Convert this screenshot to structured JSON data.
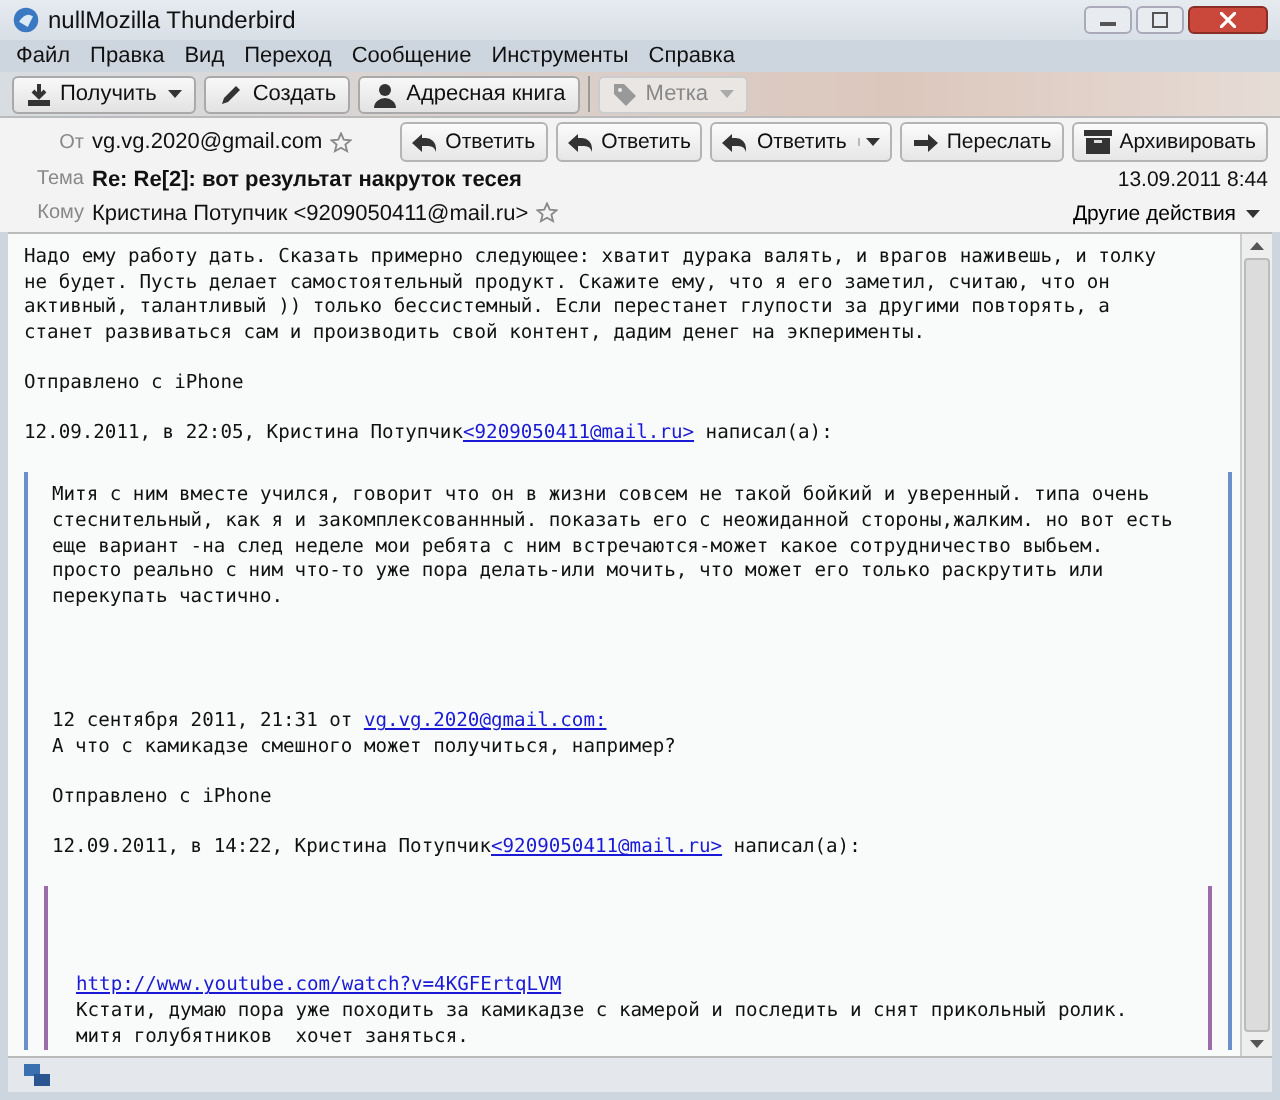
{
  "window": {
    "title": "nullMozilla Thunderbird"
  },
  "menu": [
    {
      "label": "Файл"
    },
    {
      "label": "Правка"
    },
    {
      "label": "Вид"
    },
    {
      "label": "Переход"
    },
    {
      "label": "Сообщение"
    },
    {
      "label": "Инструменты"
    },
    {
      "label": "Справка"
    }
  ],
  "toolbar": [
    {
      "label": "Получить",
      "dropdown": true,
      "disabled": false
    },
    {
      "label": "Создать",
      "dropdown": false,
      "disabled": false
    },
    {
      "label": "Адресная книга",
      "dropdown": false,
      "disabled": false
    },
    {
      "label": "Метка",
      "dropdown": true,
      "disabled": true
    }
  ],
  "message": {
    "from_label": "От",
    "from": "vg.vg.2020@gmail.com",
    "subject_label": "Тема",
    "subject": "Re: Re[2]: вот результат накруток тесея",
    "to_label": "Кому",
    "to": "Кристина Потупчик <9209050411@mail.ru>",
    "date": "13.09.2011 8:44",
    "other_actions": "Другие действия",
    "actions": [
      {
        "label": "Ответить",
        "dropdown": false
      },
      {
        "label": "Ответить",
        "dropdown": false
      },
      {
        "label": "Ответить",
        "dropdown": true
      },
      {
        "label": "Переслать",
        "dropdown": false
      },
      {
        "label": "Архивировать",
        "dropdown": false
      }
    ]
  },
  "body": [
    {
      "kind": "para",
      "text": "Надо ему работу дать. Сказать примерно следующее: хватит дурака валять, и врагов наживешь, и толку\nне будет. Пусть делает самостоятельный продукт. Скажите ему, что я его заметил, считаю, что он\nактивный, талантливый )) только бессистемный. Если перестанет глупости за другими повторять, а\nстанет развиваться сам и производить свой контент, дадим денег на экперименты."
    },
    {
      "kind": "para",
      "text": "Отправлено с iPhone"
    },
    {
      "kind": "attribution",
      "before": "12.09.2011, в 22:05, Кристина Потупчик",
      "link": "<9209050411@mail.ru>",
      "after": " написал(а):"
    },
    {
      "kind": "quote",
      "children": [
        {
          "kind": "para",
          "text": "Митя с ним вместе учился, говорит что он в жизни совсем не такой бойкий и уверенный. типа очень\nстеснительный, как я и закомплексованнный. показать его с неожиданной стороны,жалким. но вот есть\nеще вариант -на след неделе мои ребята с ним встречаются-может какое сотрудничество выбьем.\nпросто реально с ним что-то уже пора делать-или мочить, что может его только раскрутить или\nперекупать частично."
        },
        {
          "kind": "attribution",
          "before": "12 сентября 2011, 21:31 от ",
          "link": "vg.vg.2020@gmail.com:"
        },
        {
          "kind": "para",
          "text": "А что с камикадзе смешного может получиться, например?"
        },
        {
          "kind": "para",
          "text": "Отправлено с iPhone"
        },
        {
          "kind": "attribution",
          "before": "12.09.2011, в 14:22, Кристина Потупчик",
          "link": "<9209050411@mail.ru>",
          "after": " написал(а):"
        },
        {
          "kind": "quote",
          "children": [
            {
              "kind": "link",
              "text": "http://www.youtube.com/watch?v=4KGFErtqLVM"
            },
            {
              "kind": "para",
              "text": "Кстати, думаю пора уже походить за камикадзе с камерой и последить и снят прикольный ролик.\nмитя голубятников  хочет заняться."
            }
          ]
        }
      ]
    }
  ]
}
